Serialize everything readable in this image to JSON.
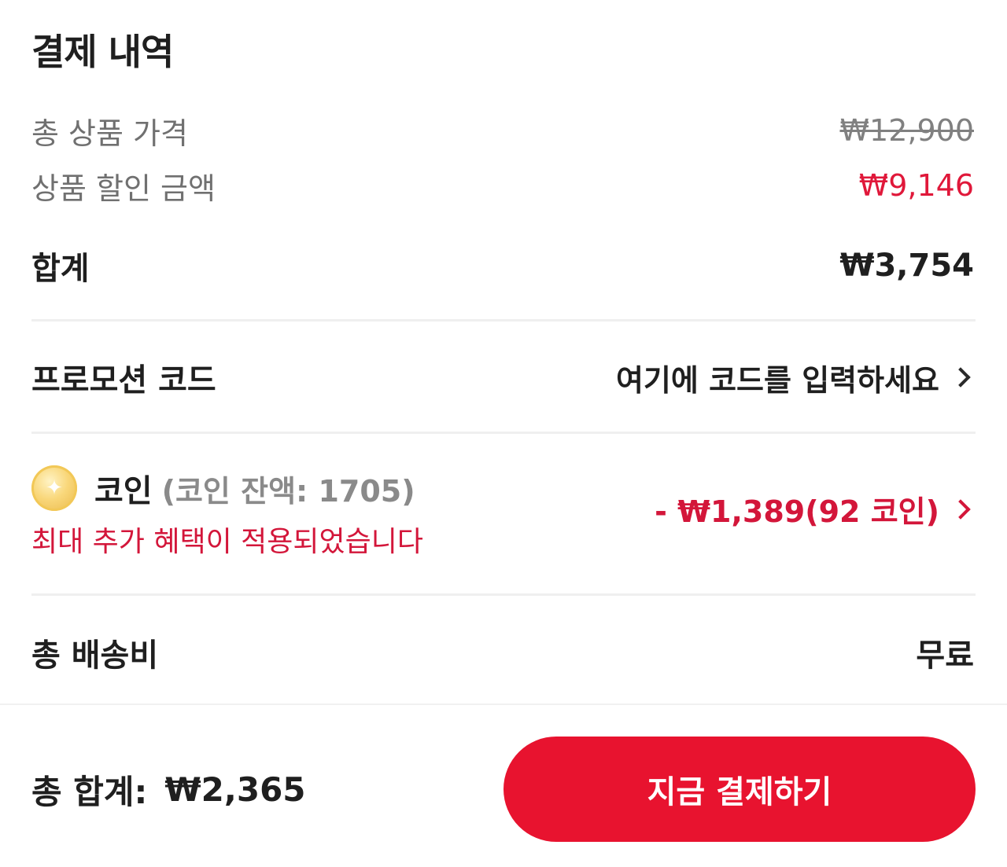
{
  "payment_summary": {
    "title": "결제 내역",
    "total_product_price": {
      "label": "총 상품 가격",
      "value": "₩12,900"
    },
    "product_discount": {
      "label": "상품 할인 금액",
      "value": "₩9,146"
    },
    "subtotal": {
      "label": "합계",
      "value": "₩3,754"
    },
    "promo_code": {
      "label": "프로모션 코드",
      "placeholder": "여기에 코드를 입력하세요"
    },
    "coin": {
      "label": "코인",
      "balance_text": "(코인 잔액: 1705)",
      "benefit_text": "최대 추가 혜택이 적용되었습니다",
      "discount_text": "- ₩1,389(92 코인)"
    },
    "shipping": {
      "label": "총 배송비",
      "value": "무료"
    }
  },
  "footer": {
    "grand_total_label": "총 합계:",
    "grand_total_value": "₩2,365",
    "pay_button_label": "지금 결제하기"
  },
  "colors": {
    "accent": "#e8132f",
    "discount_text": "#d3163a",
    "muted_text": "#707070",
    "primary_text": "#1f1f1f"
  },
  "icons": {
    "coin": "coin-icon",
    "chevron": "chevron-right-icon"
  }
}
